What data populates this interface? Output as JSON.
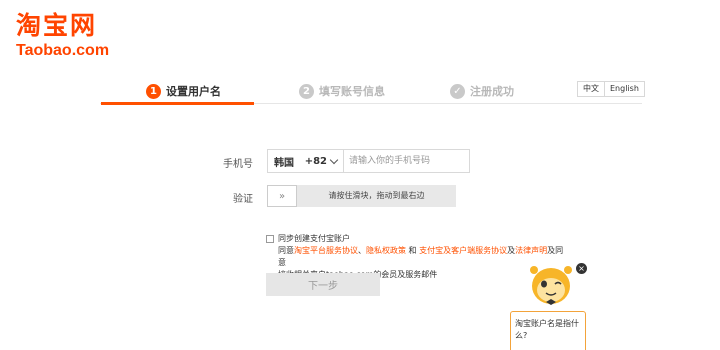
{
  "logo": {
    "cn": "淘宝网",
    "en": "Taobao.com"
  },
  "steps": [
    {
      "num": "1",
      "label": "设置用户名"
    },
    {
      "num": "2",
      "label": "填写账号信息"
    },
    {
      "num": "✓",
      "label": "注册成功"
    }
  ],
  "lang": {
    "zh": "中文",
    "en": "English"
  },
  "form": {
    "phone_label": "手机号",
    "country_name": "韩国",
    "country_code": "+82",
    "phone_placeholder": "请输入你的手机号码",
    "verify_label": "验证",
    "slider_text": "请按住滑块，拖动到最右边",
    "slider_handle": "»"
  },
  "agreement": {
    "line1": "同步创建支付宝账户",
    "prefix": "同意",
    "link1": "淘宝平台服务协议",
    "sep": "、",
    "link2": "隐私权政策",
    "and": " 和 ",
    "link3": "支付宝及客户端服务协议",
    "and2": "及",
    "link4": "法律声明",
    "suffix": "及同意",
    "line3": "接收相关来自taobao.com的会员及服务邮件"
  },
  "next_button": "下一步",
  "helper": {
    "close": "×",
    "tip": "淘宝账户名是指什么?"
  },
  "colors": {
    "accent": "#ff5000",
    "brand": "#ff4400"
  }
}
